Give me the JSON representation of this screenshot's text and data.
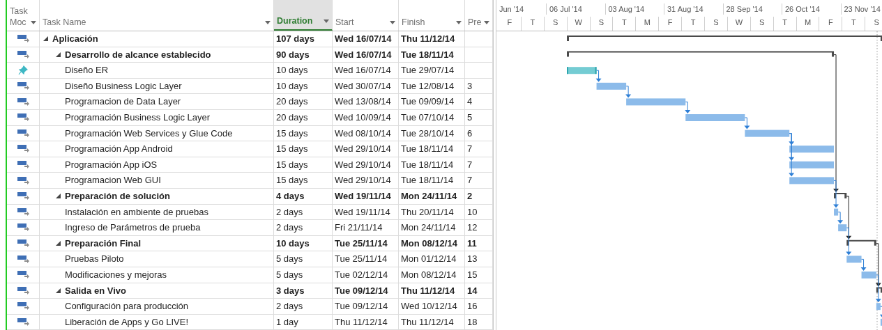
{
  "columns": [
    {
      "label": "Task Moc",
      "selected": false
    },
    {
      "label": "Task Name",
      "selected": false
    },
    {
      "label": "Duration",
      "selected": true
    },
    {
      "label": "Start",
      "selected": false
    },
    {
      "label": "Finish",
      "selected": false
    },
    {
      "label": "Pre",
      "selected": false
    }
  ],
  "timescale": {
    "months": [
      "Jun '14",
      "06 Jul '14",
      "03 Aug '14",
      "31 Aug '14",
      "28 Sep '14",
      "26 Oct '14",
      "23 Nov '14"
    ],
    "days": [
      "F",
      "T",
      "S",
      "W",
      "S",
      "T",
      "M",
      "F",
      "T",
      "S",
      "W",
      "S",
      "T",
      "M",
      "F",
      "T",
      "S"
    ]
  },
  "tasks": [
    {
      "kind": "auto",
      "name": "Aplicación",
      "duration": "107 days",
      "start": "Wed 16/07/14",
      "finish": "Thu 11/12/14",
      "expanded": true,
      "children": [
        {
          "kind": "auto",
          "name": "Desarrollo de alcance establecido",
          "duration": "90 days",
          "start": "Wed 16/07/14",
          "finish": "Tue 18/11/14",
          "expanded": true,
          "children": [
            {
              "kind": "manual",
              "name": "Diseño ER",
              "duration": "10 days",
              "start": "Wed 16/07/14",
              "finish": "Tue 29/07/14"
            },
            {
              "kind": "auto",
              "name": "Diseño Business Logic Layer",
              "duration": "10 days",
              "start": "Wed 30/07/14",
              "finish": "Tue 12/08/14",
              "predecessors": "3"
            },
            {
              "kind": "auto",
              "name": "Programacion de Data Layer",
              "duration": "20 days",
              "start": "Wed 13/08/14",
              "finish": "Tue 09/09/14",
              "predecessors": "4"
            },
            {
              "kind": "auto",
              "name": "Programación Business Logic Layer",
              "duration": "20 days",
              "start": "Wed 10/09/14",
              "finish": "Tue 07/10/14",
              "predecessors": "5"
            },
            {
              "kind": "auto",
              "name": "Programación Web Services y Glue Code",
              "duration": "15 days",
              "start": "Wed 08/10/14",
              "finish": "Tue 28/10/14",
              "predecessors": "6"
            },
            {
              "kind": "auto",
              "name": "Programación App Android",
              "duration": "15 days",
              "start": "Wed 29/10/14",
              "finish": "Tue 18/11/14",
              "predecessors": "7"
            },
            {
              "kind": "auto",
              "name": "Programación App iOS",
              "duration": "15 days",
              "start": "Wed 29/10/14",
              "finish": "Tue 18/11/14",
              "predecessors": "7"
            },
            {
              "kind": "auto",
              "name": "Programacion Web GUI",
              "duration": "15 days",
              "start": "Wed 29/10/14",
              "finish": "Tue 18/11/14",
              "predecessors": "7"
            }
          ]
        },
        {
          "kind": "auto",
          "name": "Preparación de solución",
          "duration": "4 days",
          "start": "Wed 19/11/14",
          "finish": "Mon 24/11/14",
          "predecessors": "2",
          "expanded": true,
          "children": [
            {
              "kind": "auto",
              "name": "Instalación en ambiente de pruebas",
              "duration": "2 days",
              "start": "Wed 19/11/14",
              "finish": "Thu 20/11/14",
              "predecessors": "10"
            },
            {
              "kind": "auto",
              "name": "Ingreso de Parámetros de prueba",
              "duration": "2 days",
              "start": "Fri 21/11/14",
              "finish": "Mon 24/11/14",
              "predecessors": "12"
            }
          ]
        },
        {
          "kind": "auto",
          "name": "Preparación Final",
          "duration": "10 days",
          "start": "Tue 25/11/14",
          "finish": "Mon 08/12/14",
          "predecessors": "11",
          "expanded": true,
          "children": [
            {
              "kind": "auto",
              "name": "Pruebas Piloto",
              "duration": "5 days",
              "start": "Tue 25/11/14",
              "finish": "Mon 01/12/14",
              "predecessors": "13"
            },
            {
              "kind": "auto",
              "name": "Modificaciones y mejoras",
              "duration": "5 days",
              "start": "Tue 02/12/14",
              "finish": "Mon 08/12/14",
              "predecessors": "15"
            }
          ]
        },
        {
          "kind": "auto",
          "name": "Salida en Vivo",
          "duration": "3 days",
          "start": "Tue 09/12/14",
          "finish": "Thu 11/12/14",
          "predecessors": "14",
          "expanded": true,
          "children": [
            {
              "kind": "auto",
              "name": "Configuración para producción",
              "duration": "2 days",
              "start": "Tue 09/12/14",
              "finish": "Wed 10/12/14",
              "predecessors": "16"
            },
            {
              "kind": "auto",
              "name": "Liberación de Apps y Go LIVE!",
              "duration": "1 day",
              "start": "Thu 11/12/14",
              "finish": "Thu 11/12/14",
              "predecessors": "18"
            }
          ]
        }
      ]
    }
  ]
}
